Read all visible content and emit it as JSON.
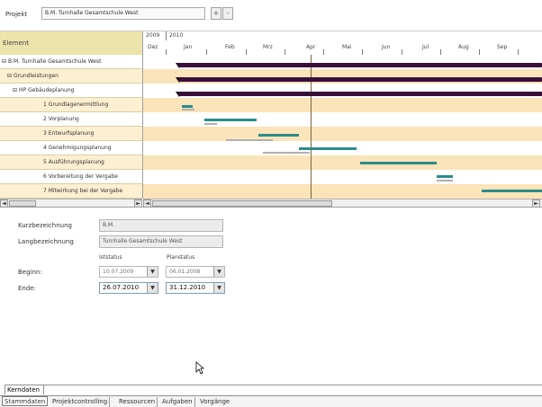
{
  "project": {
    "label": "Projekt",
    "value": "B.M. Turnhalle Gesamtschule West",
    "btn1": "+",
    "btn2": "-"
  },
  "tree": {
    "header": "Element",
    "rows": [
      "B.M. Turnhalle Gesamtschule West",
      "Grundleistungen",
      "HP Gebäudeplanung",
      "1 Grundlagenermittlung",
      "2 Vorplanung",
      "3 Entwurfsplanung",
      "4 Genehmigungsplanung",
      "5 Ausführungsplanung",
      "6 Vorbereitung der Vergabe",
      "7 Mitwirkung bei der Vergabe"
    ]
  },
  "timeline": {
    "years": [
      "2009",
      "2010"
    ],
    "months": [
      "Dez",
      "Jan",
      "Feb",
      "Mrz",
      "Apr",
      "Mai",
      "Jun",
      "Jul",
      "Aug",
      "Sep"
    ]
  },
  "scroll": {
    "left": "◄",
    "right": "►"
  },
  "form": {
    "kurzbez_label": "Kurzbezeichnung",
    "kurzbez_value": "B.M.",
    "langbez_label": "Langbezeichnung",
    "langbez_value": "Turnhalle Gesamtschule West",
    "col_ist": "Iststatus",
    "col_plan": "Planstatus",
    "beginn_label": "Beginn:",
    "beginn_ist": "10.07.2009",
    "beginn_plan": "06.01.2008",
    "ende_label": "Ende:",
    "ende_ist": "26.07.2010",
    "ende_plan": "31.12.2010",
    "dropdown_glyph": "▼"
  },
  "tabs": {
    "inner": "Kerndaten",
    "bottom": [
      "Stammdaten",
      "Projektcontrolling",
      "Ressourcen",
      "Aufgaben",
      "Vorgänge"
    ]
  },
  "colors": {
    "header_bg": "#ede4ac",
    "row_alt": "#fbe4b9",
    "summary_bar": "#3a0f3a",
    "task_bar": "#2c8b8b"
  }
}
